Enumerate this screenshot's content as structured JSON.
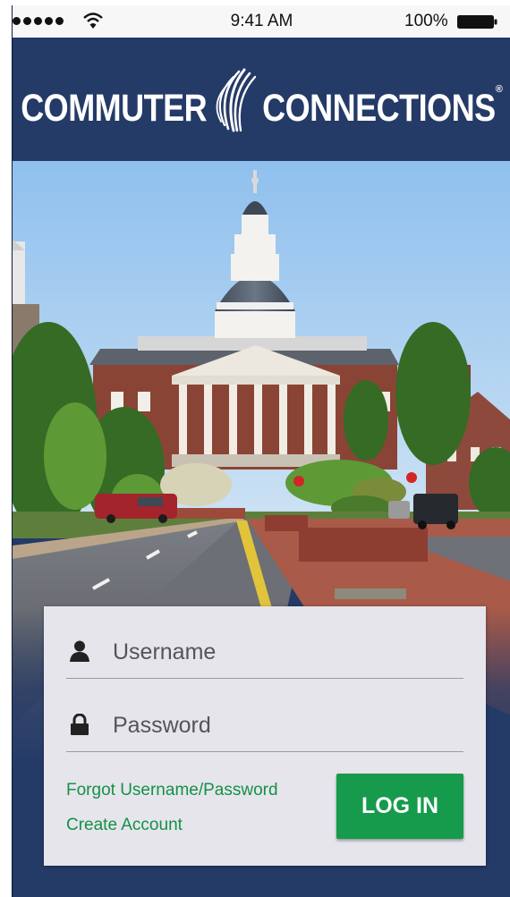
{
  "status_bar": {
    "time": "9:41 AM",
    "battery": "100%",
    "icons": [
      "signal-dots-icon",
      "wifi-icon",
      "battery-icon"
    ]
  },
  "header": {
    "logo": {
      "left_word": "COMMUTER",
      "right_word": "CONNECTIONS",
      "registered_mark": "®"
    }
  },
  "hero": {
    "icon": "state-house-photo"
  },
  "login": {
    "username": {
      "placeholder": "Username",
      "value": "",
      "icon": "user-icon"
    },
    "password": {
      "placeholder": "Password",
      "value": "",
      "icon": "lock-icon"
    },
    "forgot_link": "Forgot Username/Password",
    "create_link": "Create Account",
    "button": "LOG IN"
  },
  "colors": {
    "brand_navy": "#243a67",
    "accent_green": "#169a4b",
    "link_green": "#149145",
    "card_background": "#e6e5ec"
  }
}
